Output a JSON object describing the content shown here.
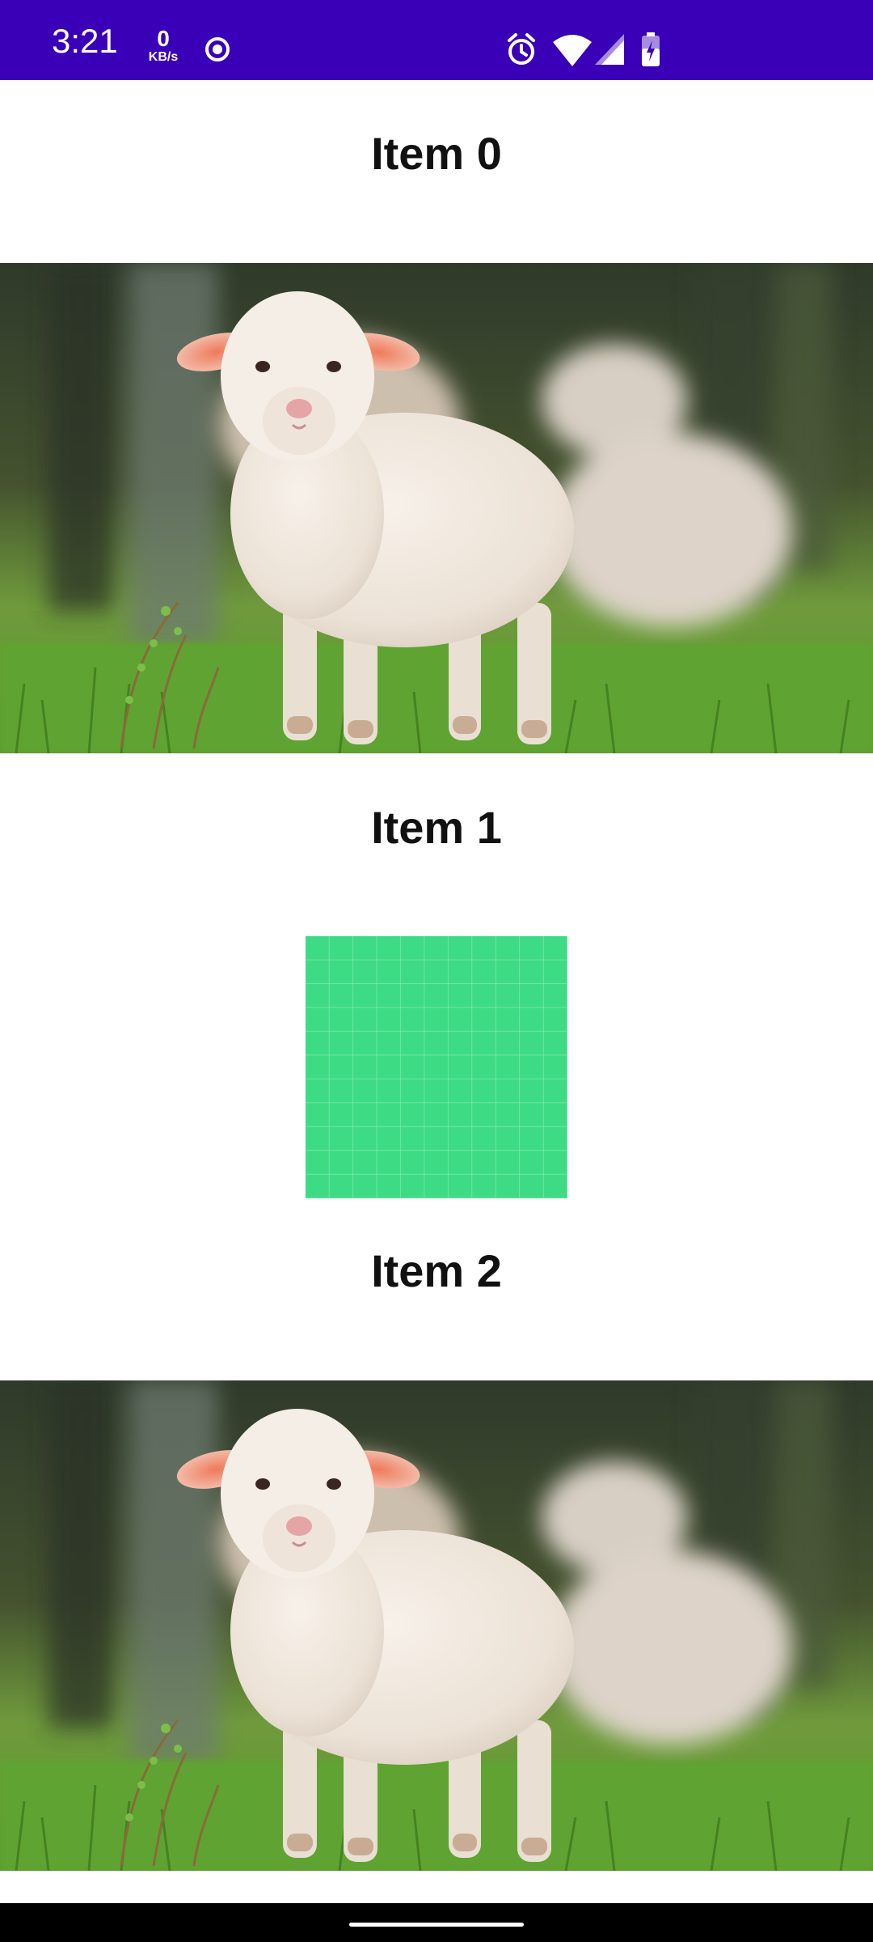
{
  "status_bar": {
    "time": "3:21",
    "net_speed_value": "0",
    "net_speed_unit": "KB/s",
    "icons": [
      "record-icon",
      "alarm-icon",
      "wifi-icon",
      "signal-icon",
      "battery-charging-icon"
    ]
  },
  "items": [
    {
      "title": "Item 0",
      "media": "lamb-photo"
    },
    {
      "title": "Item 1",
      "media": "green-grid-tile"
    },
    {
      "title": "Item 2",
      "media": "lamb-photo"
    }
  ],
  "colors": {
    "status_bar": "#3a00b8",
    "tile_green": "#3ddc84",
    "background": "#ffffff",
    "nav_bar": "#000000"
  }
}
